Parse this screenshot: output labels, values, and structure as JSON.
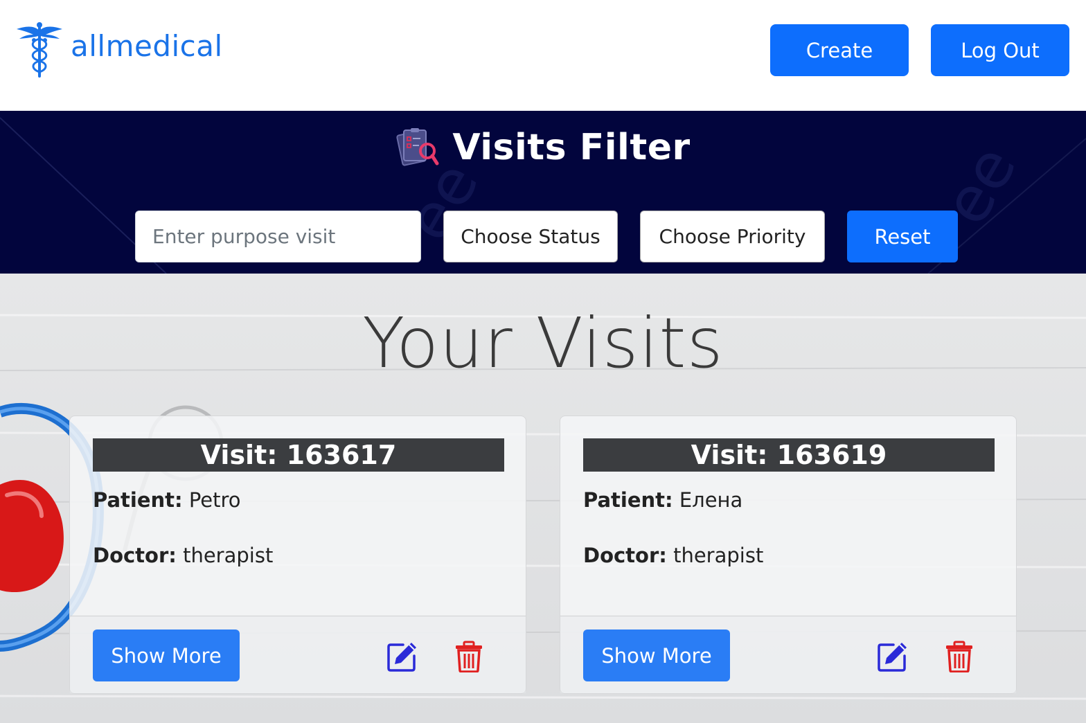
{
  "header": {
    "brand": "allmedical",
    "create_label": "Create",
    "logout_label": "Log Out"
  },
  "filter": {
    "title": "Visits Filter",
    "purpose_placeholder": "Enter purpose visit",
    "status_label": "Choose Status",
    "priority_label": "Choose Priority",
    "reset_label": "Reset"
  },
  "main": {
    "title": "Your Visits",
    "cards": [
      {
        "visit_title": "Visit: 163617",
        "patient_label": "Patient:",
        "patient_value": "Petro",
        "doctor_label": "Doctor:",
        "doctor_value": "therapist",
        "show_more_label": "Show More"
      },
      {
        "visit_title": "Visit: 163619",
        "patient_label": "Patient:",
        "patient_value": "Елена",
        "doctor_label": "Doctor:",
        "doctor_value": "therapist",
        "show_more_label": "Show More"
      }
    ]
  },
  "icons": {
    "logo": "caduceus-icon",
    "filter": "clipboard-search-icon",
    "edit": "edit-icon",
    "delete": "trash-icon"
  },
  "colors": {
    "primary": "#0d6efd",
    "brand_text": "#1a73e8",
    "filter_bg": "#02053d",
    "card_header_bg": "#3b3d40",
    "edit_icon": "#2a2ad8",
    "delete_icon": "#e02020"
  }
}
